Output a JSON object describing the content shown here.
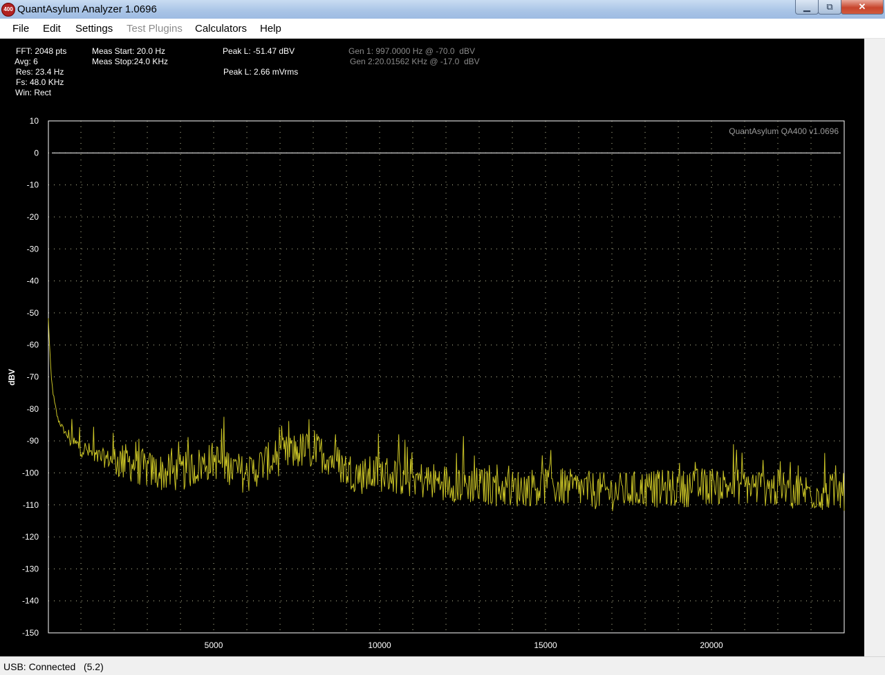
{
  "window": {
    "icon_text": "400",
    "title": "QuantAsylum Analyzer 1.0696"
  },
  "menu": {
    "items": [
      {
        "label": "File",
        "enabled": true
      },
      {
        "label": "Edit",
        "enabled": true
      },
      {
        "label": "Settings",
        "enabled": true
      },
      {
        "label": "Test Plugins",
        "enabled": false
      },
      {
        "label": "Calculators",
        "enabled": true
      },
      {
        "label": "Help",
        "enabled": true
      }
    ]
  },
  "info": {
    "fft": "FFT: 2048 pts",
    "avg": "Avg: 6",
    "res": "Res: 23.4 Hz",
    "fs": "Fs: 48.0 KHz",
    "win": "Win: Rect",
    "meas_start": "Meas Start: 20.0 Hz",
    "meas_stop": "Meas Stop:24.0 KHz",
    "peak_dbv": "Peak L: -51.47 dBV",
    "peak_mv": "Peak L: 2.66 mVrms",
    "gen1": "Gen 1: 997.0000 Hz @ -70.0  dBV",
    "gen2": "Gen 2:20.01562 KHz @ -17.0  dBV"
  },
  "chart_data": {
    "type": "line",
    "watermark": "QuantAsylum QA400 v1.0696",
    "ylabel": "dBV",
    "xlabel": "",
    "ylim": [
      -150,
      10
    ],
    "xlim": [
      20,
      24000
    ],
    "y_ticks": [
      10,
      0,
      -10,
      -20,
      -30,
      -40,
      -50,
      -60,
      -70,
      -80,
      -90,
      -100,
      -110,
      -120,
      -130,
      -140,
      -150
    ],
    "x_ticks": [
      5000,
      10000,
      15000,
      20000
    ],
    "grid": true,
    "reference_line_db": 0,
    "series": [
      {
        "color": "#c9c326",
        "x": [
          20,
          100,
          200,
          300,
          500,
          800,
          1000,
          1500,
          2000,
          2500,
          3000,
          3500,
          4000,
          4500,
          5000,
          5500,
          6000,
          6500,
          7000,
          7500,
          8000,
          8500,
          9000,
          9500,
          10000,
          11000,
          12000,
          13000,
          14000,
          15000,
          16000,
          17000,
          18000,
          19000,
          20000,
          21000,
          22000,
          23000,
          24000
        ],
        "values": [
          -52,
          -70,
          -78,
          -83,
          -87,
          -91,
          -92,
          -95,
          -96,
          -97,
          -99,
          -100,
          -100,
          -98,
          -96,
          -98,
          -101,
          -97,
          -95,
          -93,
          -93,
          -95,
          -99,
          -101,
          -100,
          -102,
          -103,
          -104,
          -105,
          -104,
          -105,
          -106,
          -105,
          -105,
          -104,
          -104,
          -105,
          -106,
          -106
        ]
      }
    ]
  },
  "status": {
    "text": "USB: Connected   (5.2)"
  }
}
